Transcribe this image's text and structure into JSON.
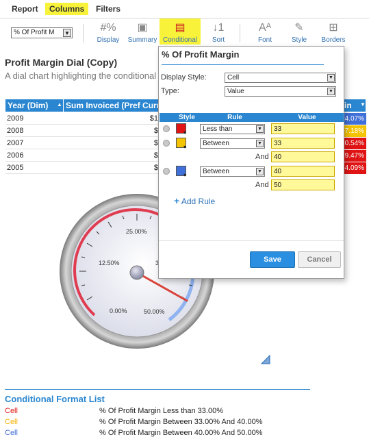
{
  "menu": {
    "report": "Report",
    "columns": "Columns",
    "filters": "Filters"
  },
  "toolbar": {
    "field_select": "% Of Profit M",
    "buttons": [
      {
        "label": "Display",
        "icon": "#%"
      },
      {
        "label": "Summary",
        "icon": "▣"
      },
      {
        "label": "Conditional",
        "icon": "▤"
      },
      {
        "label": "Sort",
        "icon": "↓1"
      },
      {
        "label": "Font",
        "icon": "Aᴬ"
      },
      {
        "label": "Style",
        "icon": "✎"
      },
      {
        "label": "Borders",
        "icon": "⊞"
      }
    ]
  },
  "report": {
    "title": "Profit Margin Dial (Copy)",
    "subtitle": "A dial chart highlighting the conditional",
    "table": {
      "headers": [
        "Year (Dim)",
        "Sum Invoiced (Pref Curr"
      ],
      "right_header": "in",
      "rows": [
        {
          "year": "2009",
          "amount": "$1",
          "pct": "4.07%",
          "color": "#3f6fd8"
        },
        {
          "year": "2008",
          "amount": "$",
          "pct": "7.18%",
          "color": "#f5c400"
        },
        {
          "year": "2007",
          "amount": "$",
          "pct": "0.54%",
          "color": "#e01414"
        },
        {
          "year": "2006",
          "amount": "$",
          "pct": "9.47%",
          "color": "#e01414"
        },
        {
          "year": "2005",
          "amount": "$",
          "pct": "4.09%",
          "color": "#e01414"
        }
      ]
    }
  },
  "dial": {
    "labels": [
      "25.00%",
      "12.50%",
      "3",
      "0.00%",
      "50.00%"
    ],
    "colors": {
      "red_arc": "#e03c50",
      "blue_arc": "#6f9ce8",
      "needle": "#d9453c"
    }
  },
  "popup": {
    "title": "% Of Profit Margin",
    "display_style_label": "Display Style:",
    "display_style_value": "Cell",
    "type_label": "Type:",
    "type_value": "Value",
    "columns": [
      "Style",
      "Rule",
      "Value"
    ],
    "rules": [
      {
        "color": "#e01414",
        "rule": "Less than",
        "value": "33",
        "and_label": "",
        "and_value": ""
      },
      {
        "color": "#f5c400",
        "rule": "Between",
        "value": "33",
        "and_label": "And",
        "and_value": "40"
      },
      {
        "color": "#3f6fd8",
        "rule": "Between",
        "value": "40",
        "and_label": "And",
        "and_value": "50"
      }
    ],
    "add_rule": "Add Rule",
    "save": "Save",
    "cancel": "Cancel"
  },
  "cfl": {
    "title": "Conditional Format List",
    "items": [
      {
        "type": "Cell",
        "color": "#e01414",
        "desc": "% Of Profit Margin Less than 33.00%"
      },
      {
        "type": "Cell",
        "color": "#f5b000",
        "desc": "% Of Profit Margin Between 33.00% And 40.00%"
      },
      {
        "type": "Cell",
        "color": "#3f6fd8",
        "desc": "% Of Profit Margin Between 40.00% And 50.00%"
      }
    ]
  }
}
